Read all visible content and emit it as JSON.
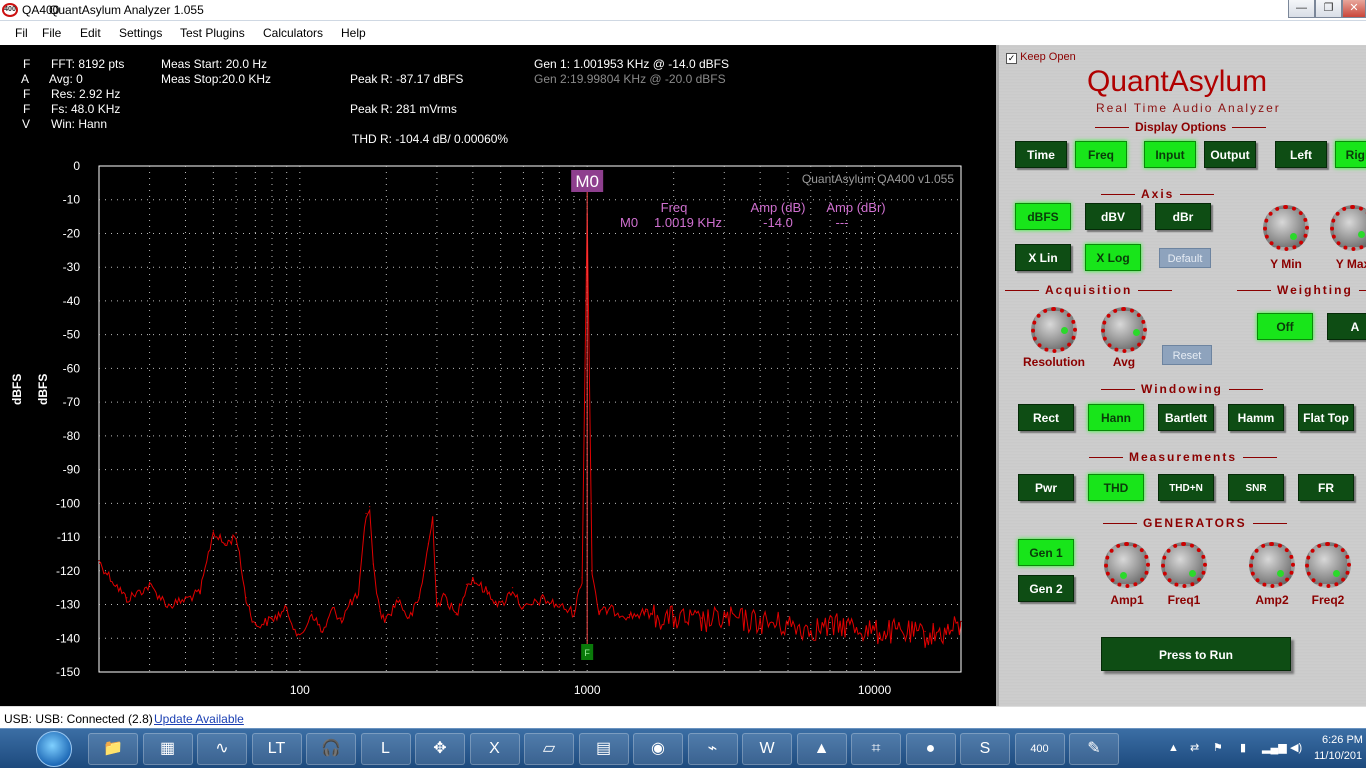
{
  "window": {
    "icon_text": "400",
    "app_prefix": "QA400",
    "title": "QuantAsylum Analyzer 1.055",
    "minimize": "—",
    "restore": "❐",
    "close": "✕"
  },
  "menu": [
    "Fil",
    "File",
    "Edit",
    "Settings",
    "Test Plugins",
    "Calculators",
    "Help"
  ],
  "info": {
    "left_letters": [
      "F",
      "A",
      "F",
      "F",
      "V"
    ],
    "fft": "FFT: 8192 pts",
    "avg": "Avg: 0",
    "res": "Res: 2.92 Hz",
    "fs": "Fs: 48.0 KHz",
    "win": "Win: Hann",
    "meas_start": "Meas Start: 20.0 Hz",
    "meas_stop": "Meas Stop:20.0 KHz",
    "peak_dbfs": "Peak R: -87.17 dBFS",
    "peak_vrms": "Peak R: 281 mVrms",
    "thd": "THD R: -104.4 dB/ 0.00060%",
    "gen1": "Gen 1: 1.001953 KHz @ -14.0  dBFS",
    "gen2": "Gen 2:19.99804 KHz @ -20.0  dBFS"
  },
  "chart_data": {
    "type": "line",
    "watermark": "QuantAsylum QA400 v1.055",
    "ylabel": "dBFS",
    "ylabel2": "dBFS",
    "x_scale": "log",
    "xlim": [
      20,
      20000
    ],
    "ylim": [
      -150,
      0
    ],
    "x_ticks": [
      100,
      1000,
      10000
    ],
    "y_ticks": [
      0,
      -10,
      -20,
      -30,
      -40,
      -50,
      -60,
      -70,
      -80,
      -90,
      -100,
      -110,
      -120,
      -130,
      -140,
      -150
    ],
    "grid": true,
    "series_color": "#e00000",
    "marker": {
      "label": "M0",
      "freq": 1000,
      "bottom_tag": "F",
      "headers": [
        "Freq",
        "Amp (dB)",
        "Amp (dBr)"
      ],
      "row": [
        "M0",
        "1.0019 KHz",
        "-14.0",
        "---"
      ]
    },
    "series": [
      {
        "x": [
          20,
          25,
          30,
          35,
          40,
          45,
          50,
          55,
          60,
          65,
          70,
          80,
          90,
          100,
          110,
          120,
          130,
          140,
          150,
          160,
          170,
          175,
          180,
          190,
          200,
          220,
          240,
          260,
          280,
          290,
          300,
          320,
          350,
          380,
          400,
          450,
          500,
          550,
          600,
          700,
          800,
          900,
          960,
          1000,
          1040,
          1100,
          1200,
          1400,
          1600,
          2000,
          2500,
          3000,
          4000,
          5000,
          6000,
          8000,
          10000,
          12000,
          15000,
          18000,
          20000
        ],
        "y": [
          -117,
          -128,
          -124,
          -130,
          -128,
          -126,
          -108,
          -112,
          -109,
          -128,
          -136,
          -134,
          -131,
          -140,
          -132,
          -138,
          -131,
          -134,
          -129,
          -127,
          -103,
          -101,
          -118,
          -132,
          -134,
          -128,
          -134,
          -128,
          -112,
          -104,
          -130,
          -127,
          -133,
          -124,
          -122,
          -126,
          -130,
          -125,
          -131,
          -128,
          -130,
          -132,
          -122,
          -12,
          -120,
          -132,
          -131,
          -133,
          -132,
          -133,
          -134,
          -133,
          -134,
          -135,
          -136,
          -135,
          -137,
          -137,
          -138,
          -137,
          -135
        ]
      }
    ]
  },
  "panel": {
    "keep_open": "Keep Open",
    "brand": "QuantAsylum",
    "brand_sub": "Real Time Audio Analyzer",
    "display_options": "Display Options",
    "display_buttons": [
      "Time",
      "Freq",
      "Input",
      "Output",
      "Left",
      "Right"
    ],
    "axis": "Axis",
    "axis_buttons": [
      "dBFS",
      "dBV",
      "dBr"
    ],
    "x_buttons": [
      "X Lin",
      "X Log"
    ],
    "default_btn": "Default",
    "ymin": "Y Min",
    "ymax": "Y Max",
    "acquisition": "Acquisition",
    "resolution": "Resolution",
    "avg": "Avg",
    "reset_btn": "Reset",
    "weighting": "Weighting",
    "weight_buttons": [
      "Off",
      "A"
    ],
    "windowing": "Windowing",
    "window_buttons": [
      "Rect",
      "Hann",
      "Bartlett",
      "Hamm",
      "Flat Top"
    ],
    "measurements": "Measurements",
    "meas_buttons": [
      "Pwr",
      "THD",
      "THD+N",
      "SNR",
      "FR"
    ],
    "generators": "GENERATORS",
    "gen_buttons": [
      "Gen 1",
      "Gen 2"
    ],
    "amp1": "Amp1",
    "freq1": "Freq1",
    "amp2": "Amp2",
    "freq2": "Freq2",
    "run": "Press to Run"
  },
  "status": {
    "usb": "USB: USB: Connected  (2.8)",
    "update": "Update Available"
  },
  "taskbar": {
    "icons": [
      "folder-icon",
      "qa-meter-icon",
      "scope-icon",
      "lt-icon",
      "audio-icon",
      "l-icon",
      "select-icon",
      "excel-icon",
      "clipboard-icon",
      "calc-icon",
      "chrome-icon",
      "acrobat-icon",
      "word-icon",
      "fox-icon",
      "frame-icon",
      "paint-icon",
      "skype-icon",
      "qa400-icon",
      "palette-icon"
    ],
    "time": "6:26 PM",
    "date": "11/10/201"
  }
}
